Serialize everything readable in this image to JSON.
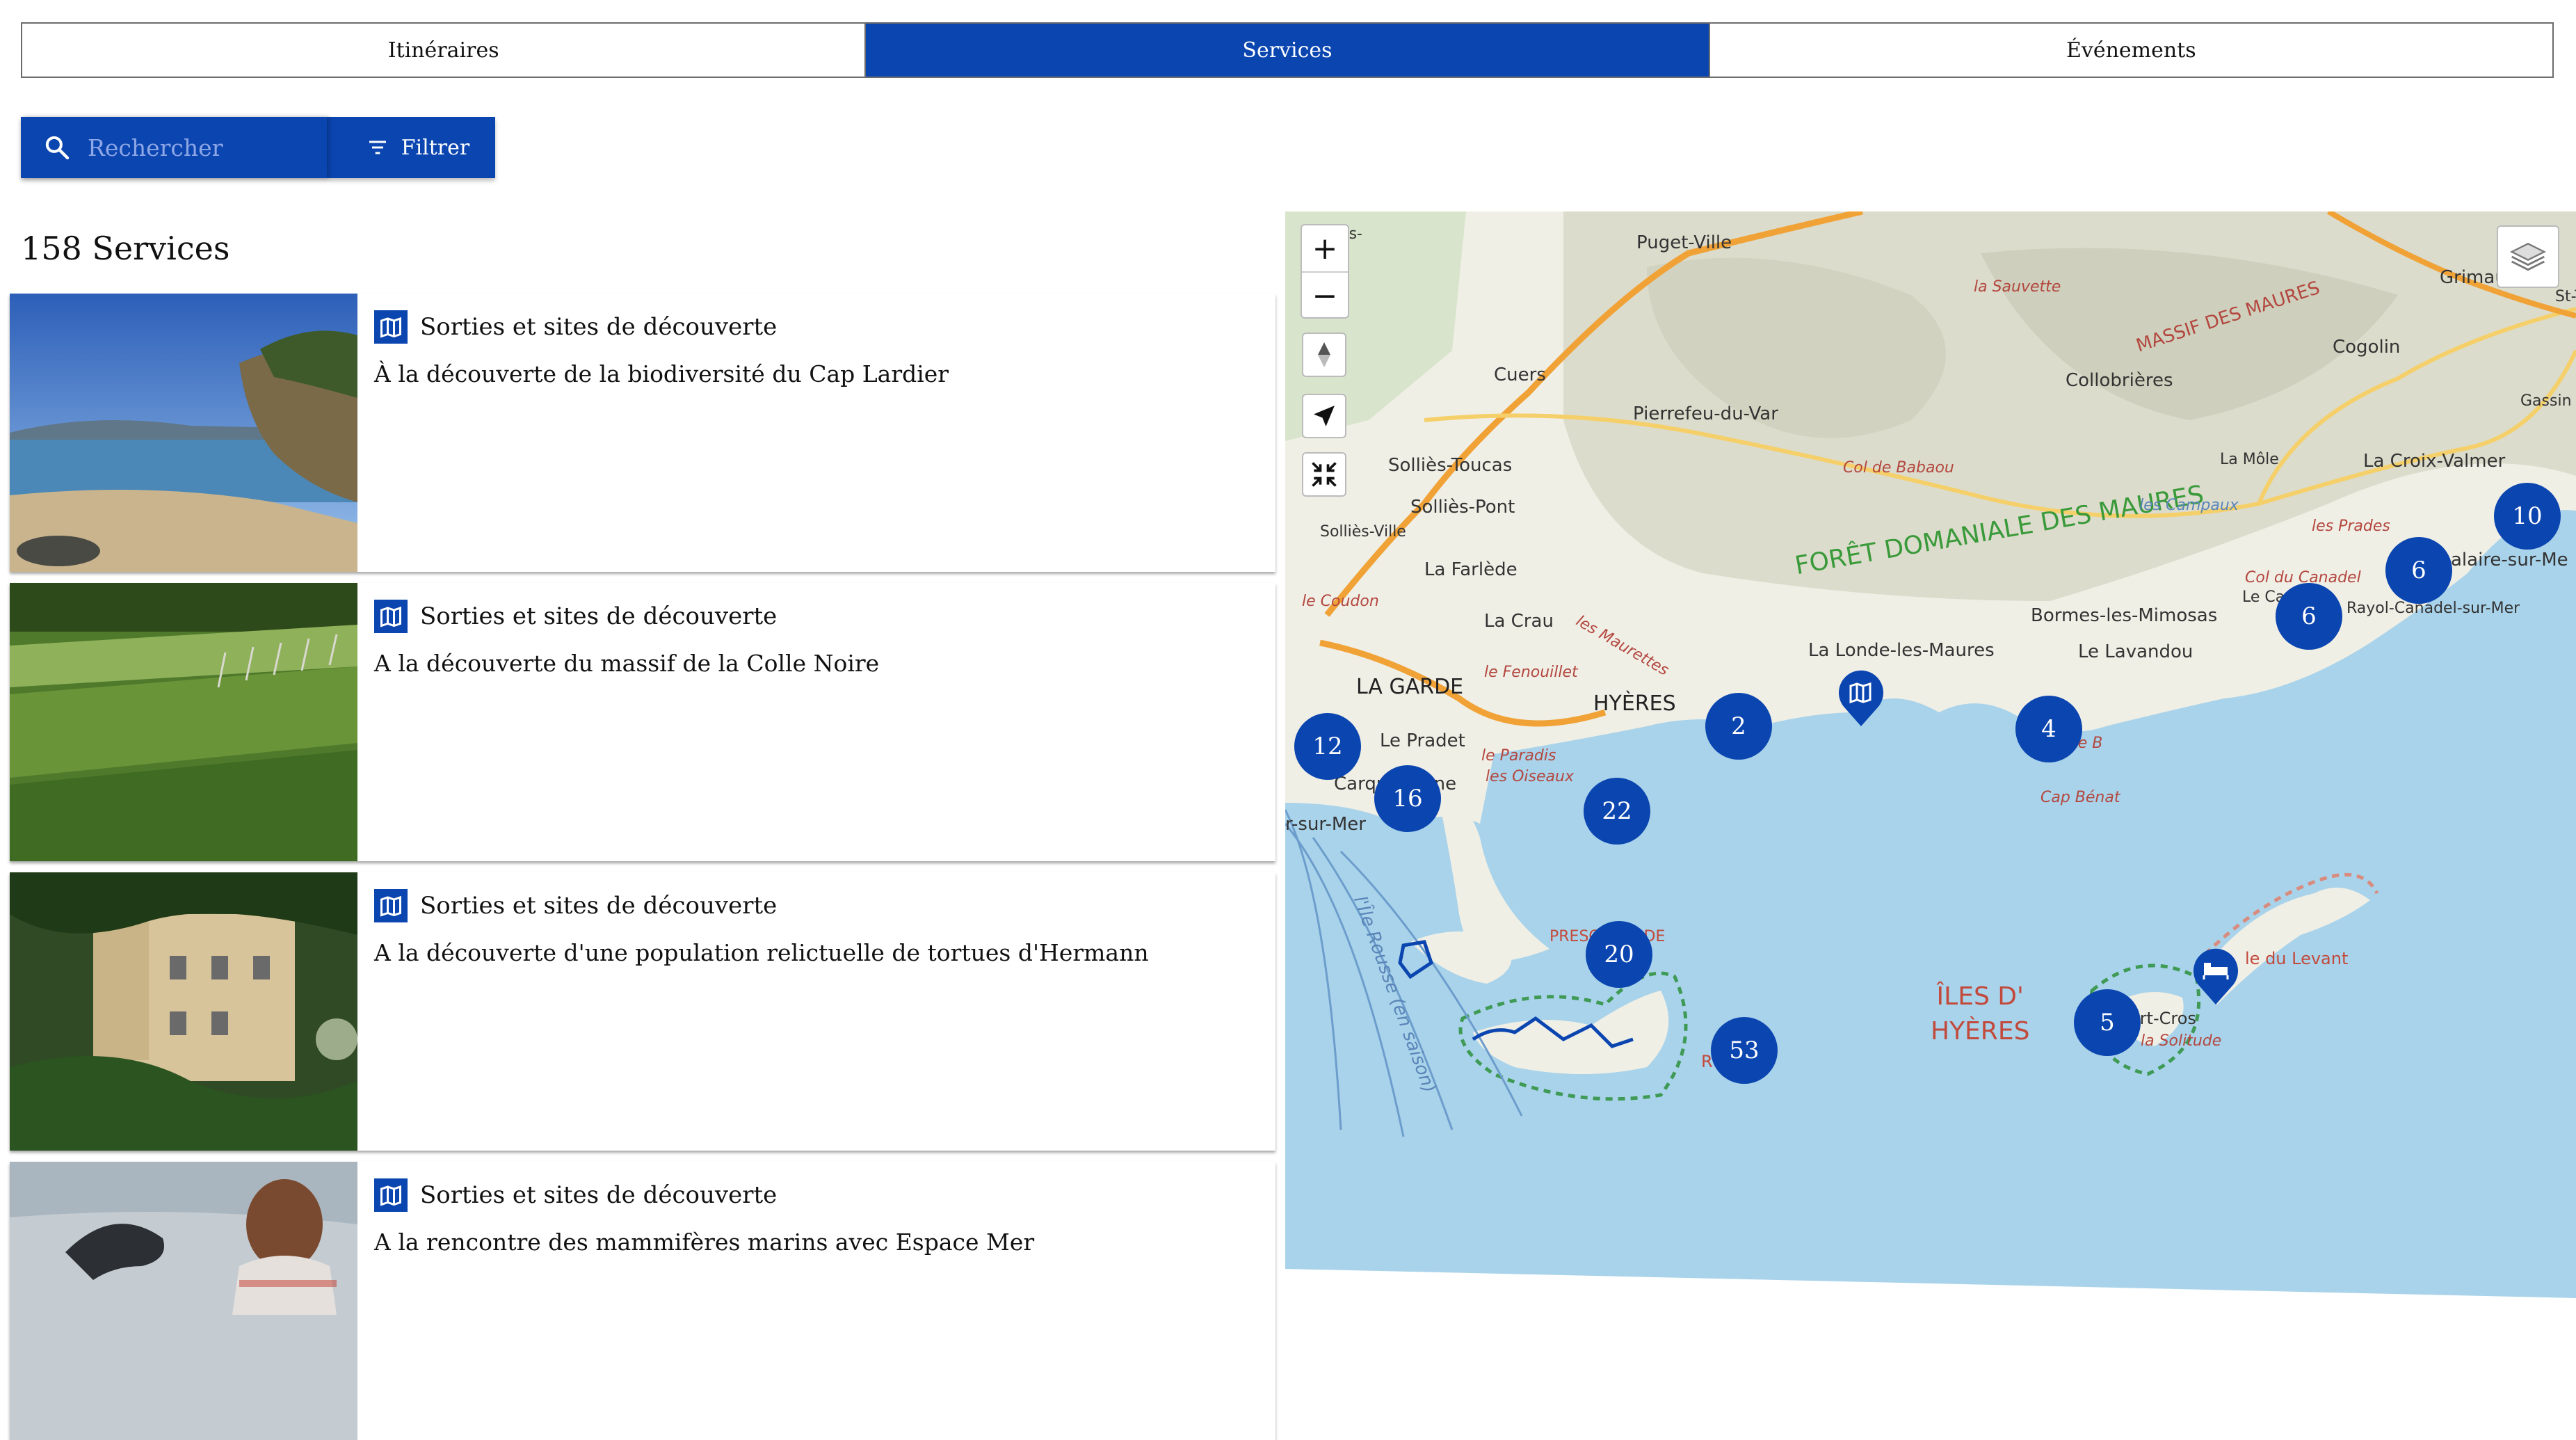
{
  "tabs": [
    {
      "label": "Itinéraires",
      "active": false
    },
    {
      "label": "Services",
      "active": true
    },
    {
      "label": "Événements",
      "active": false
    }
  ],
  "search": {
    "placeholder": "Rechercher",
    "icon": "search-icon"
  },
  "filter": {
    "label": "Filtrer",
    "icon": "filter-icon"
  },
  "results": {
    "count_label": "158 Services",
    "items": [
      {
        "category": "Sorties et sites de découverte",
        "title": "À la découverte de la biodiversité du Cap Lardier",
        "icon": "map-icon"
      },
      {
        "category": "Sorties et sites de découverte",
        "title": "A la découverte du massif de la Colle Noire",
        "icon": "map-icon"
      },
      {
        "category": "Sorties et sites de découverte",
        "title": "A la découverte d'une population relictuelle de tortues d'Hermann",
        "icon": "map-icon"
      },
      {
        "category": "Sorties et sites de découverte",
        "title": "A la rencontre des mammifères marins avec Espace Mer",
        "icon": "map-icon"
      }
    ]
  },
  "map": {
    "controls": {
      "zoom_in": "+",
      "zoom_out": "−"
    },
    "clusters": [
      "12",
      "16",
      "22",
      "20",
      "2",
      "53",
      "4",
      "5",
      "6",
      "6",
      "10"
    ],
    "places": {
      "puget": "Puget-Ville",
      "cuers": "Cuers",
      "pierrefeu": "Pierrefeu-du-Var",
      "sollies_toucas": "Solliès-Toucas",
      "sollies_pont": "Solliès-Pont",
      "sollies_ville": "Solliès-Ville",
      "farlede": "La Farlède",
      "crau": "La Crau",
      "garde": "LA GARDE",
      "hyeres": "HYÈRES",
      "pradet": "Le Pradet",
      "carqueiranne": "Carqueiranne",
      "sur_mer": "r-sur-Mer",
      "londe": "La Londe-les-Maures",
      "bormes": "Bormes-les-Mimosas",
      "lavandou": "Le Lavandou",
      "canadel": "Le Canadel",
      "rayol": "Rayol-Canadel-sur-Mer",
      "collobrieres": "Collobrières",
      "mole": "La Môle",
      "croix_valmer": "La Croix-Valmer",
      "cogolin": "Cogolin",
      "grimaud": "Grimaud",
      "gassin": "Gassin",
      "st_t": "St-T",
      "cavalaire": "alaire-sur-Me",
      "les_sollies_top": "-lès-\nux",
      "foret": "FORÊT DOMANIALE DES MAURES",
      "massif": "MASSIF DES MAURES",
      "sauvette": "la Sauvette",
      "babaou": "Col de Babaou",
      "campaux": "les Campaux",
      "prades": "les Prades",
      "col_canadel": "Col du Canadel",
      "coudon": "le Coudon",
      "fenouillet": "le Fenouillet",
      "maurettes": "les Maurettes",
      "paradis": "le Paradis",
      "oiseaux": "les Oiseaux",
      "cap_benat": "Cap Bénat",
      "cap_de_b": "Cap de B",
      "iles_line1": "ÎLES D'",
      "iles_line2": "HYÈRES",
      "presqu": "PRESQU'ÎLE DE",
      "porquerolles": "ROLLES",
      "levant": "le du Levant",
      "port_cros": "ort-Cros",
      "solitude": "la Solitude",
      "ile_rousse": "l'Île Rousse (en saison)"
    }
  },
  "colors": {
    "accent": "#0b45b0",
    "sea": "#a9d3ea",
    "land": "#f0efe6"
  }
}
